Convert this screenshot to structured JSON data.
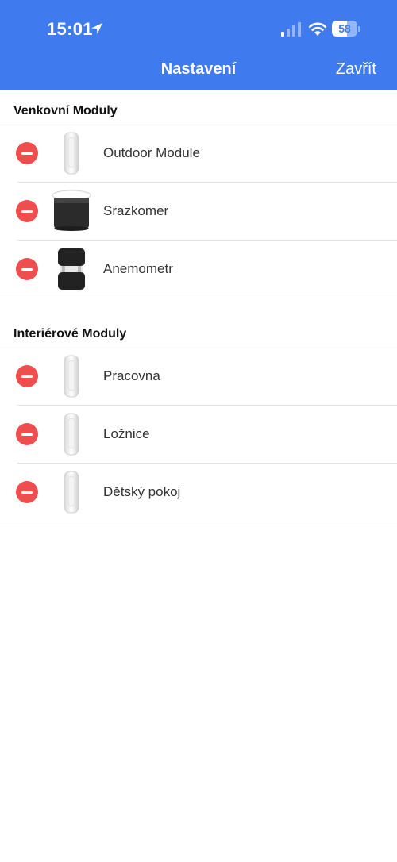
{
  "status_bar": {
    "time": "15:01",
    "battery": "58",
    "battery_level": 0.58
  },
  "nav": {
    "title": "Nastavení",
    "close_label": "Zavřít"
  },
  "sections": [
    {
      "title": "Venkovní Moduly",
      "items": [
        {
          "label": "Outdoor Module",
          "icon": "outdoor-module-image"
        },
        {
          "label": "Srazkomer",
          "icon": "rain-gauge-image"
        },
        {
          "label": "Anemometr",
          "icon": "anemometer-image"
        }
      ]
    },
    {
      "title": "Interiérové Moduly",
      "items": [
        {
          "label": "Pracovna",
          "icon": "indoor-module-image"
        },
        {
          "label": "Ložnice",
          "icon": "indoor-module-image"
        },
        {
          "label": "Dětský pokoj",
          "icon": "indoor-module-image"
        }
      ]
    }
  ],
  "colors": {
    "header": "#3f7bef",
    "delete": "#ef4e4e"
  }
}
